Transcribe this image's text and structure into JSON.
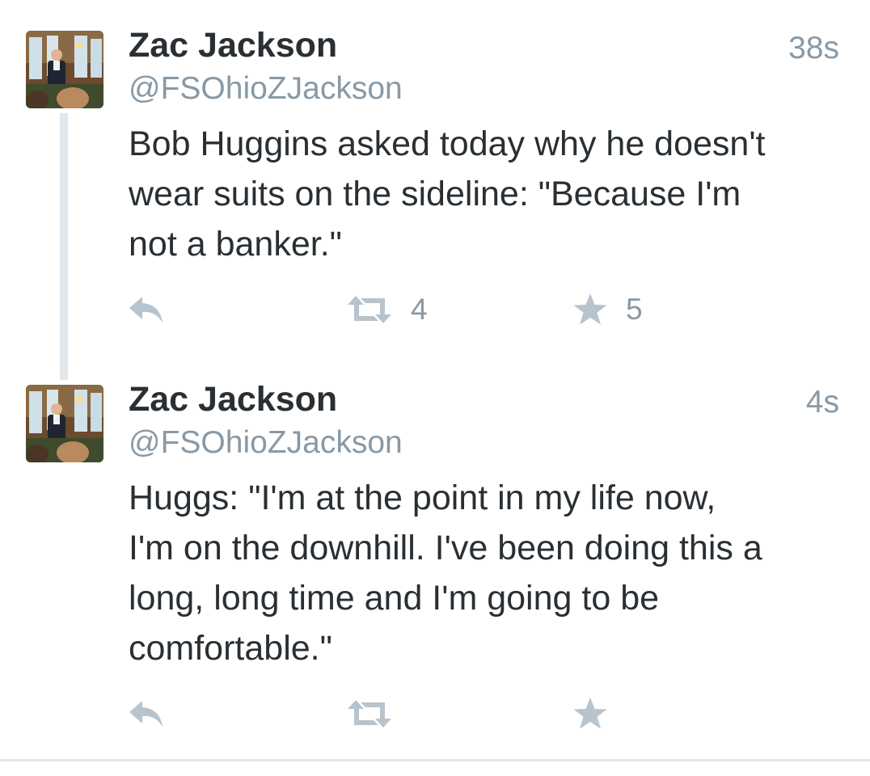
{
  "thread": {
    "tweets": [
      {
        "author_name": "Zac Jackson",
        "author_handle": "@FSOhioZJackson",
        "timestamp": "38s",
        "text": "Bob Huggins asked today why he doesn't\nwear suits on the sideline: \"Because I'm\nnot a banker.\"",
        "retweet_count": "4",
        "favorite_count": "5",
        "icons": {
          "avatar": "profile-photo",
          "reply": "reply-icon",
          "retweet": "retweet-icon",
          "favorite": "star-icon"
        }
      },
      {
        "author_name": "Zac Jackson",
        "author_handle": "@FSOhioZJackson",
        "timestamp": "4s",
        "text": "Huggs: \"I'm at the point in my life now,\nI'm on the downhill. I've been doing this a\nlong, long time and I'm going to be\ncomfortable.\"",
        "retweet_count": "",
        "favorite_count": "",
        "icons": {
          "avatar": "profile-photo",
          "reply": "reply-icon",
          "retweet": "retweet-icon",
          "favorite": "star-icon"
        }
      }
    ]
  },
  "colors": {
    "text": "#292f33",
    "secondary": "#8899a6",
    "icon": "#b7c3cd",
    "thread_line": "#e1e8ed",
    "background": "#ffffff"
  }
}
